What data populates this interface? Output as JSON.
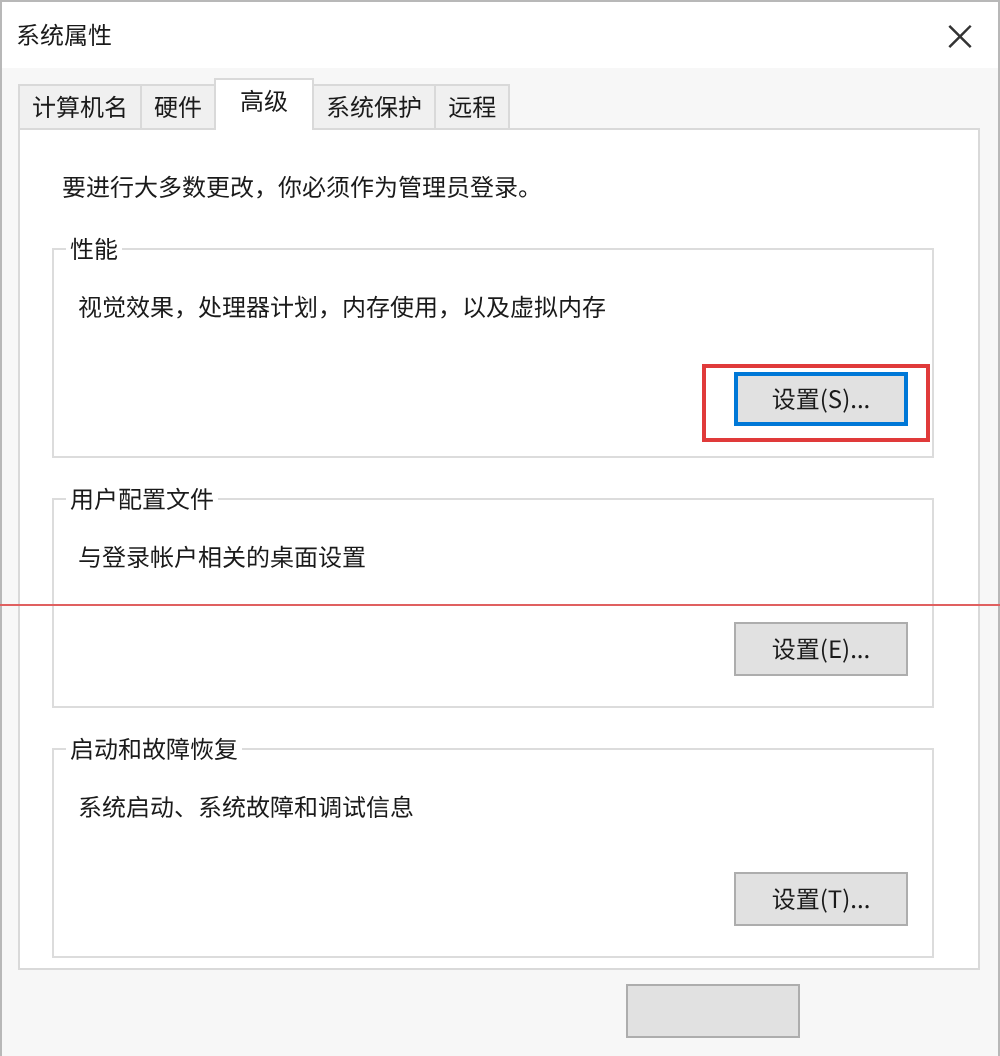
{
  "window": {
    "title": "系统属性",
    "close": "×"
  },
  "tabs": [
    {
      "label": "计算机名",
      "selected": false
    },
    {
      "label": "硬件",
      "selected": false
    },
    {
      "label": "高级",
      "selected": true
    },
    {
      "label": "系统保护",
      "selected": false
    },
    {
      "label": "远程",
      "selected": false
    }
  ],
  "notice": "要进行大多数更改，你必须作为管理员登录。",
  "groups": [
    {
      "title": "性能",
      "description": "视觉效果，处理器计划，内存使用，以及虚拟内存",
      "button": {
        "label": "设置(S)...",
        "focused": true,
        "highlighted": true
      }
    },
    {
      "title": "用户配置文件",
      "description": "与登录帐户相关的桌面设置",
      "button": {
        "label": "设置(E)...",
        "focused": false,
        "highlighted": false
      }
    },
    {
      "title": "启动和故障恢复",
      "description": "系统启动、系统故障和调试信息",
      "button": {
        "label": "设置(T)...",
        "focused": false,
        "highlighted": false
      }
    }
  ],
  "annotation_line": true,
  "footer_buttons": [
    {
      "kind": "blank"
    }
  ]
}
